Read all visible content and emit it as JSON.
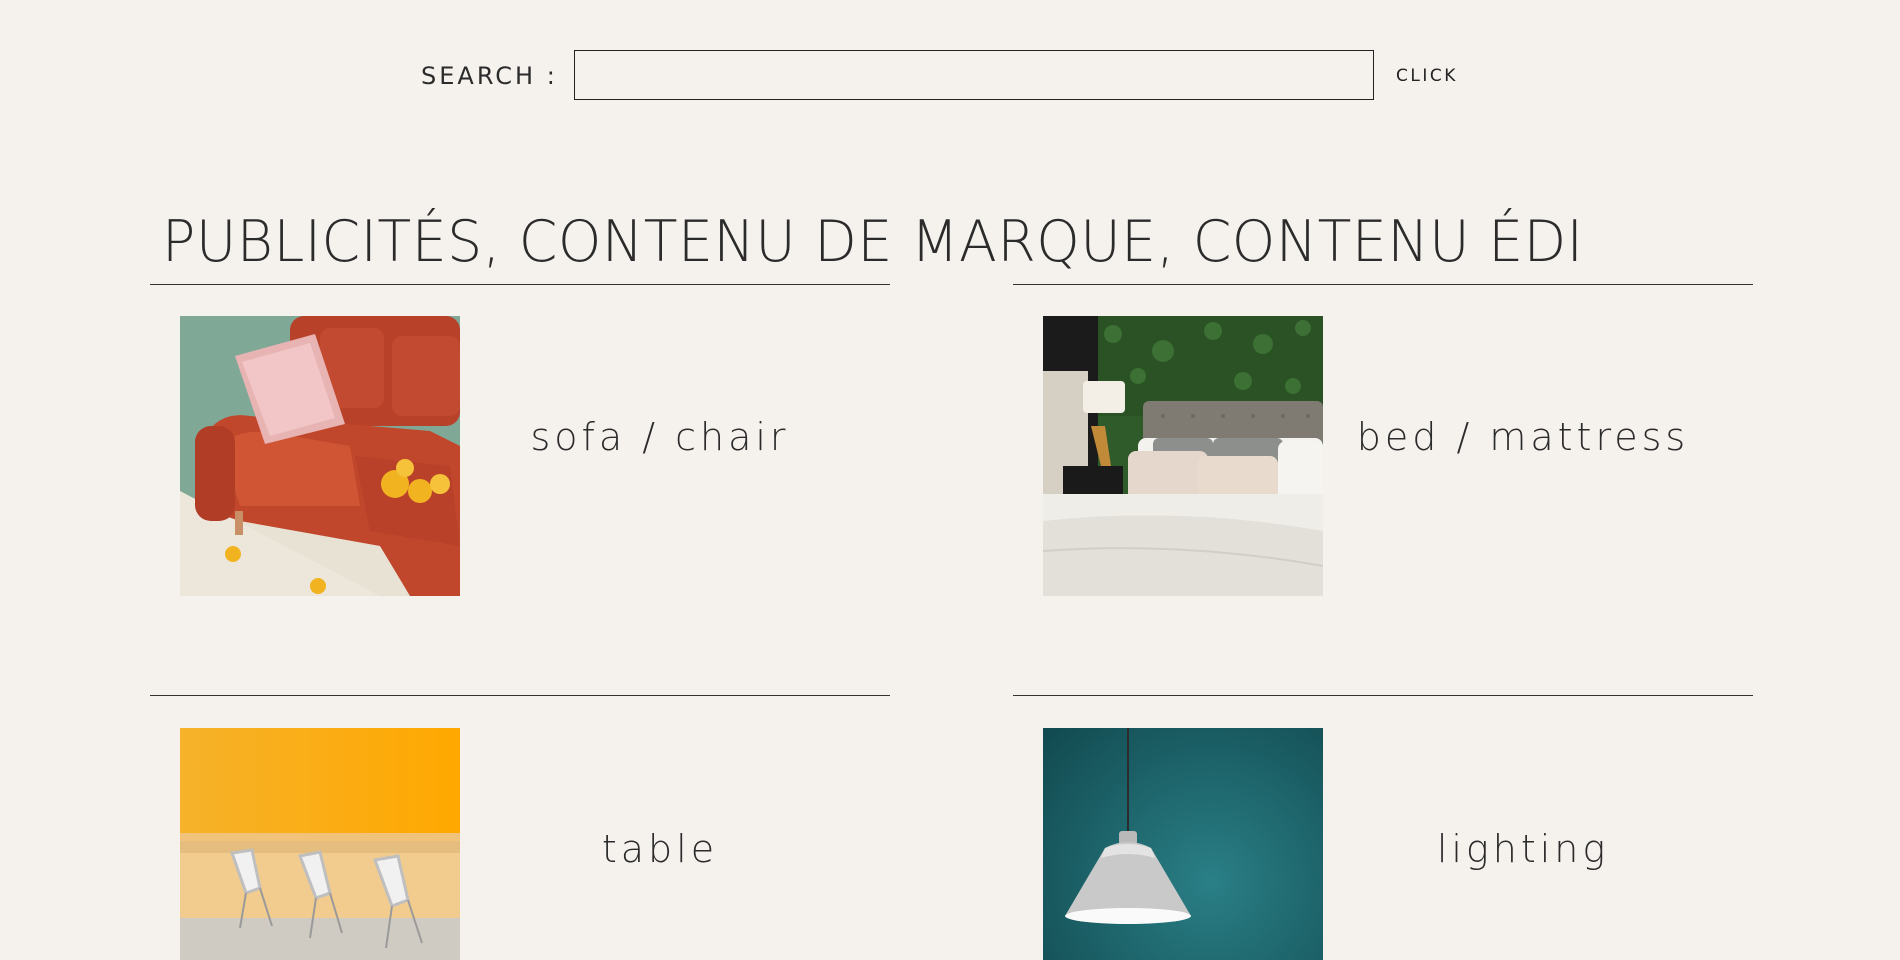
{
  "search": {
    "label": "SEARCH :",
    "value": "",
    "placeholder": "",
    "button_label": "CLICK"
  },
  "heading": "PUBLICITÉS, CONTENU DE MARQUE, CONTENU ÉDI",
  "categories": [
    {
      "label": "sofa / chair"
    },
    {
      "label": "bed / mattress"
    },
    {
      "label": "table"
    },
    {
      "label": "lighting"
    }
  ],
  "colors": {
    "background": "#f5f2ed",
    "text": "#2b2b2b",
    "rule": "#333333"
  }
}
